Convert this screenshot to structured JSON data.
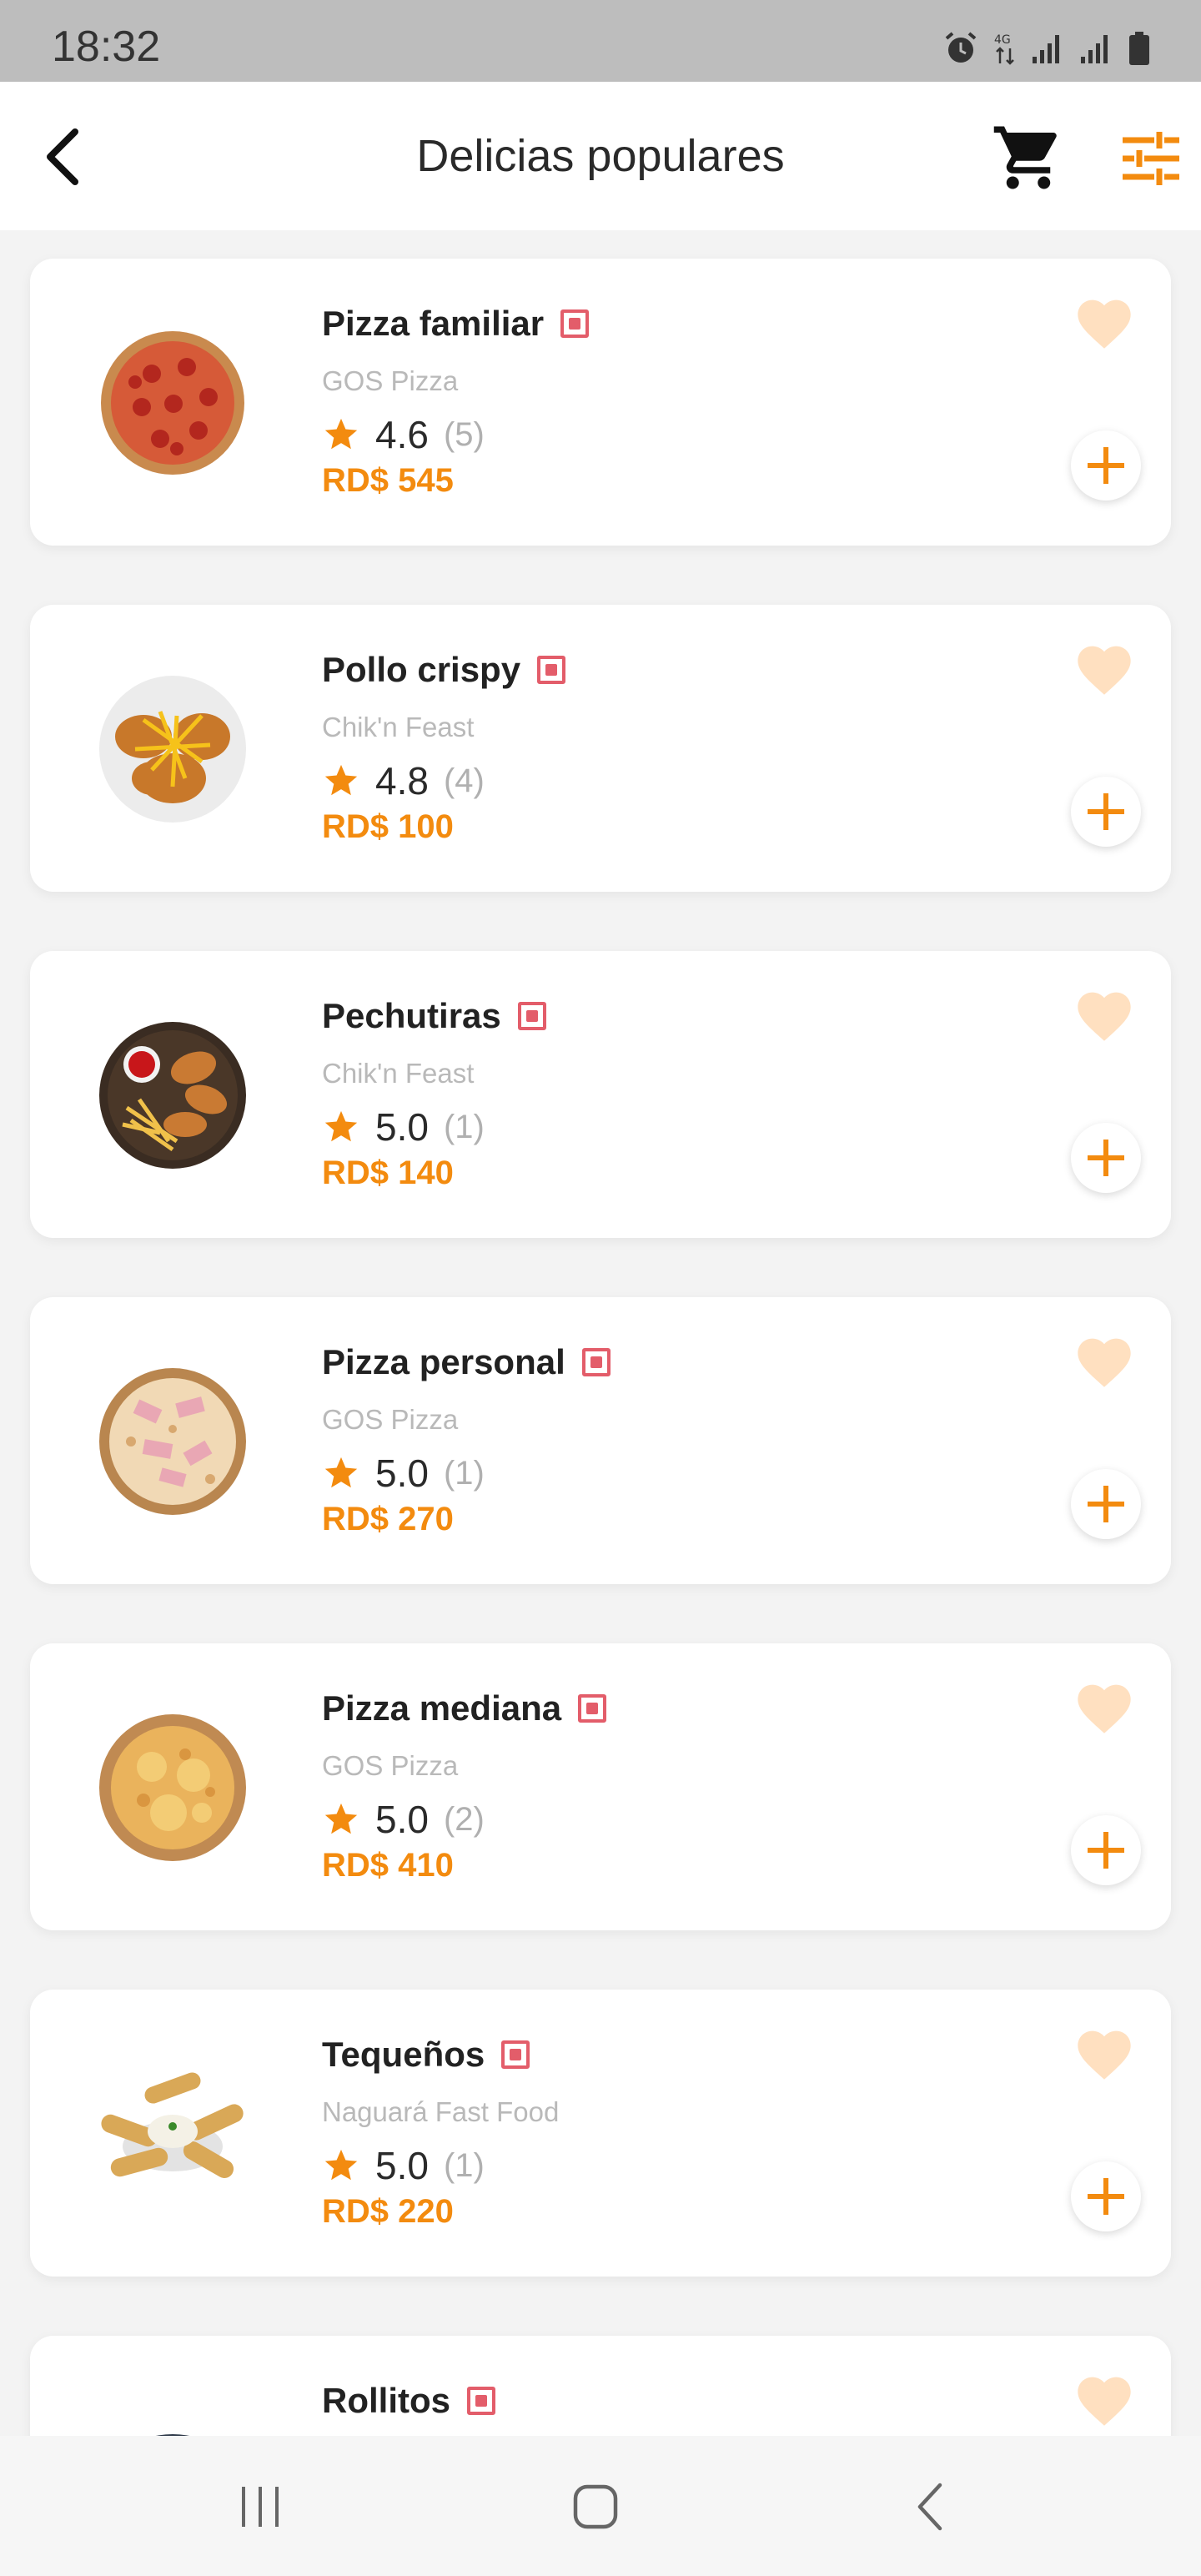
{
  "status_bar": {
    "time": "18:32",
    "icons": [
      "alarm-icon",
      "data-4g-icon",
      "signal-icon",
      "signal-icon",
      "battery-icon"
    ]
  },
  "header": {
    "title": "Delicias populares",
    "back_icon": "chevron-left-icon",
    "cart_icon": "cart-icon",
    "filter_icon": "sliders-icon"
  },
  "theme": {
    "accent": "#f38b0f",
    "heart": "#ffe0c0",
    "badge": "#e35d6a"
  },
  "items": [
    {
      "name": "Pizza familiar",
      "restaurant": "GOS Pizza",
      "rating": "4.6",
      "count": "(5)",
      "price": "RD$ 545",
      "image": "pepperoni-pizza"
    },
    {
      "name": "Pollo crispy",
      "restaurant": "Chik'n Feast",
      "rating": "4.8",
      "count": "(4)",
      "price": "RD$ 100",
      "image": "crispy-chicken"
    },
    {
      "name": "Pechutiras",
      "restaurant": "Chik'n Feast",
      "rating": "5.0",
      "count": "(1)",
      "price": "RD$ 140",
      "image": "chicken-strips-fries"
    },
    {
      "name": "Pizza personal",
      "restaurant": "GOS Pizza",
      "rating": "5.0",
      "count": "(1)",
      "price": "RD$ 270",
      "image": "ham-pizza"
    },
    {
      "name": "Pizza mediana",
      "restaurant": "GOS Pizza",
      "rating": "5.0",
      "count": "(2)",
      "price": "RD$ 410",
      "image": "cheese-pizza"
    },
    {
      "name": "Tequeños",
      "restaurant": "Naguará Fast Food",
      "rating": "5.0",
      "count": "(1)",
      "price": "RD$ 220",
      "image": "tequenos"
    },
    {
      "name": "Rollitos",
      "restaurant": "",
      "rating": "",
      "count": "",
      "price": "",
      "image": "rolls"
    }
  ],
  "nav": {
    "recents_icon": "recents-icon",
    "home_icon": "home-icon",
    "back_icon": "back-icon"
  }
}
